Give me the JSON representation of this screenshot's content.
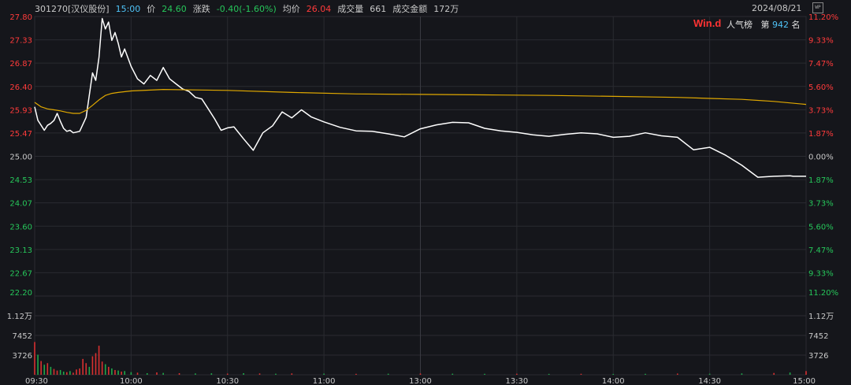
{
  "header": {
    "code_name": "301270[汉仪股份]",
    "time": "15:00",
    "price_label": "价",
    "price": "24.60",
    "change_label": "涨跌",
    "change": "-0.40(-1.60%)",
    "avg_label": "均价",
    "avg": "26.04",
    "volume_label": "成交量",
    "volume": "661",
    "amount_label": "成交金额",
    "amount": "172万",
    "date": "2024/08/21",
    "wp_icon": "WP"
  },
  "brand": {
    "logo": "Win.d",
    "popularity_label": "人气榜",
    "rank_prefix": "第",
    "rank": "942",
    "rank_suffix": "名"
  },
  "colors": {
    "background": "#15161b",
    "up": "#ff3b3b",
    "down": "#26c65a",
    "price_line": "#ffffff",
    "avg_line": "#e0a800",
    "grid": "#2a2b31",
    "volume_up": "#d83030",
    "volume_down": "#1fa84a"
  },
  "chart_data": {
    "type": "line",
    "title": "",
    "xlabel": "",
    "ylabel": "",
    "prev_close": 25.0,
    "y_ticks_left": [
      "27.80",
      "27.33",
      "26.87",
      "26.40",
      "25.93",
      "25.47",
      "25.00",
      "24.53",
      "24.07",
      "23.60",
      "23.13",
      "22.67",
      "22.20"
    ],
    "y_ticks_right": [
      "11.20%",
      "9.33%",
      "7.47%",
      "5.60%",
      "3.73%",
      "1.87%",
      "0.00%",
      "1.87%",
      "3.73%",
      "5.60%",
      "7.47%",
      "9.33%",
      "11.20%"
    ],
    "ylim": [
      22.2,
      27.8
    ],
    "x_ticks": [
      "09:30",
      "10:00",
      "10:30",
      "11:00",
      "13:00",
      "13:30",
      "14:00",
      "14:30",
      "15:00"
    ],
    "volume_ticks": [
      "1.12万",
      "7452",
      "3726"
    ],
    "series": [
      {
        "name": "",
        "kind": "price",
        "x": [
          0,
          1,
          2,
          3,
          4,
          5,
          6,
          7,
          8,
          9,
          10,
          11,
          12,
          14,
          16,
          18,
          19,
          20,
          21,
          22,
          23,
          24,
          25,
          26,
          27,
          28,
          30,
          32,
          34,
          36,
          38,
          40,
          42,
          44,
          46,
          48,
          50,
          52,
          54,
          56,
          58,
          60,
          62,
          65,
          68,
          71,
          74,
          77,
          80,
          83,
          86,
          90,
          95,
          100,
          105,
          110,
          115,
          120,
          125,
          130,
          135,
          140,
          145,
          150,
          155,
          160,
          165,
          170,
          175,
          180,
          185,
          190,
          195,
          200,
          205,
          210,
          215,
          220,
          225,
          230,
          235,
          236,
          237,
          238,
          239,
          240
        ],
        "y": [
          25.99,
          25.72,
          25.62,
          25.52,
          25.62,
          25.66,
          25.72,
          25.86,
          25.7,
          25.56,
          25.5,
          25.52,
          25.47,
          25.5,
          25.78,
          26.67,
          26.52,
          26.98,
          27.76,
          27.55,
          27.69,
          27.32,
          27.48,
          27.26,
          26.99,
          27.15,
          26.8,
          26.55,
          26.45,
          26.62,
          26.52,
          26.78,
          26.55,
          26.45,
          26.35,
          26.3,
          26.18,
          26.15,
          25.95,
          25.75,
          25.52,
          25.57,
          25.59,
          25.35,
          25.12,
          25.47,
          25.61,
          25.89,
          25.77,
          25.93,
          25.79,
          25.69,
          25.58,
          25.51,
          25.5,
          25.45,
          25.39,
          25.55,
          25.63,
          25.68,
          25.67,
          25.56,
          25.51,
          25.48,
          25.43,
          25.4,
          25.44,
          25.47,
          25.45,
          25.38,
          25.4,
          25.47,
          25.41,
          25.38,
          25.13,
          25.18,
          25.02,
          24.82,
          24.58,
          24.6,
          24.61,
          24.6,
          24.6,
          24.6,
          24.6,
          24.6
        ]
      },
      {
        "name": "",
        "kind": "average",
        "x": [
          0,
          2,
          4,
          6,
          8,
          10,
          12,
          14,
          16,
          18,
          20,
          22,
          24,
          26,
          30,
          40,
          60,
          80,
          100,
          120,
          140,
          160,
          180,
          200,
          210,
          220,
          230,
          240
        ],
        "y": [
          26.08,
          25.99,
          25.95,
          25.93,
          25.91,
          25.88,
          25.86,
          25.86,
          25.92,
          26.02,
          26.13,
          26.22,
          26.26,
          26.28,
          26.31,
          26.34,
          26.32,
          26.28,
          26.25,
          26.24,
          26.23,
          26.22,
          26.2,
          26.18,
          26.16,
          26.14,
          26.1,
          26.04
        ]
      }
    ],
    "volume": {
      "x": [
        0,
        1,
        2,
        3,
        4,
        5,
        6,
        7,
        8,
        9,
        10,
        11,
        12,
        13,
        14,
        15,
        16,
        17,
        18,
        19,
        20,
        21,
        22,
        23,
        24,
        25,
        26,
        27,
        28,
        30,
        32,
        35,
        38,
        40,
        45,
        50,
        55,
        60,
        65,
        70,
        75,
        80,
        90,
        100,
        110,
        120,
        130,
        140,
        150,
        160,
        170,
        180,
        190,
        200,
        210,
        220,
        230,
        235,
        240
      ],
      "values": [
        6200,
        3800,
        2600,
        1900,
        2200,
        1500,
        1100,
        800,
        900,
        600,
        500,
        700,
        400,
        1000,
        1200,
        3000,
        2200,
        1500,
        3500,
        4100,
        5500,
        2500,
        2000,
        1500,
        1200,
        900,
        800,
        600,
        700,
        500,
        400,
        300,
        450,
        350,
        300,
        250,
        280,
        220,
        300,
        250,
        200,
        260,
        220,
        180,
        200,
        240,
        210,
        180,
        200,
        170,
        190,
        160,
        180,
        230,
        200,
        260,
        340,
        420,
        700
      ],
      "up": [
        true,
        false,
        true,
        false,
        true,
        false,
        true,
        true,
        false,
        false,
        true,
        false,
        true,
        true,
        true,
        true,
        true,
        false,
        true,
        true,
        true,
        true,
        false,
        true,
        false,
        true,
        false,
        true,
        false,
        false,
        true,
        false,
        true,
        false,
        true,
        false,
        false,
        true,
        false,
        true,
        false,
        true,
        false,
        true,
        false,
        true,
        false,
        false,
        true,
        false,
        true,
        false,
        false,
        true,
        false,
        false,
        true,
        false,
        true
      ]
    }
  }
}
